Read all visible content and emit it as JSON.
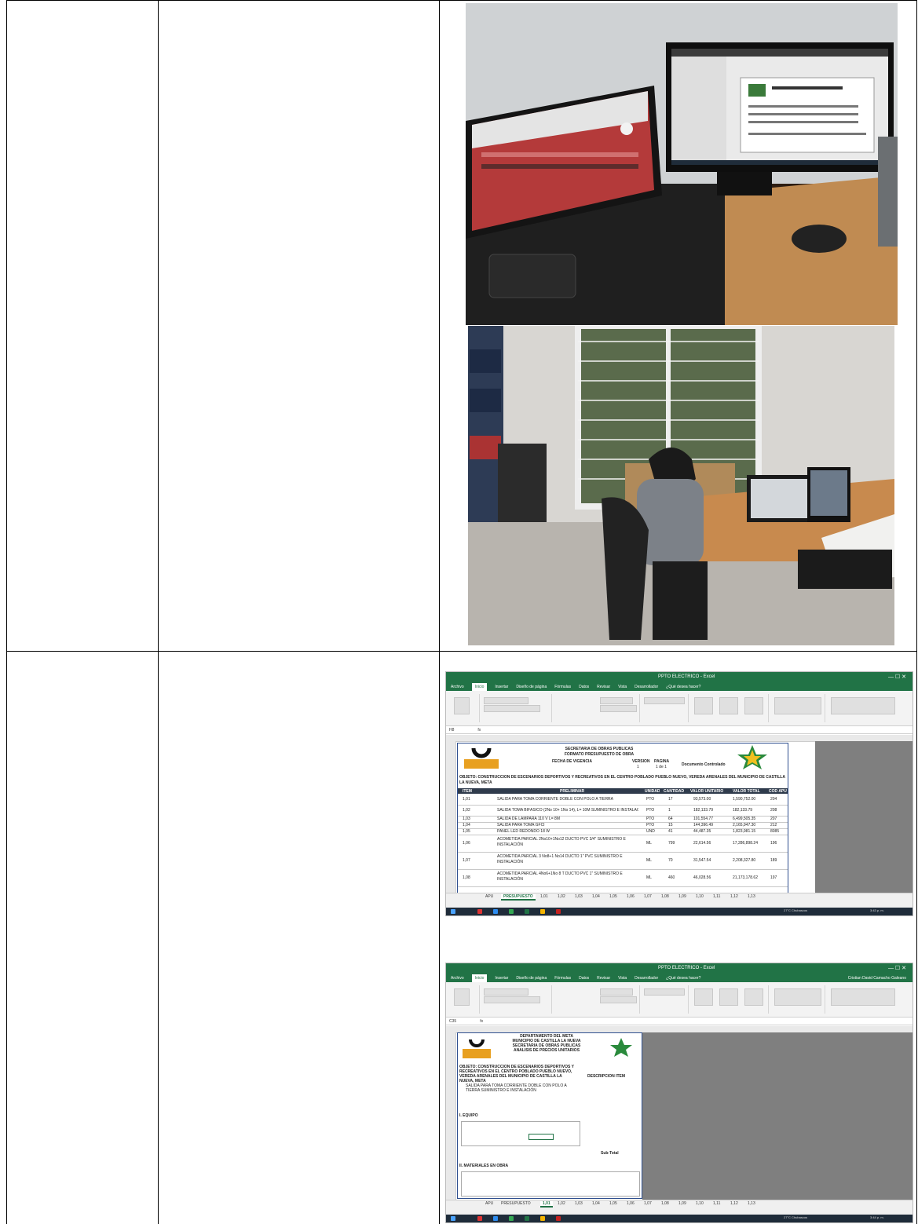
{
  "excel1": {
    "window_title": "PPTO ELECTRICO - Excel",
    "tabs": [
      "Archivo",
      "Inicio",
      "Insertar",
      "Diseño de página",
      "Fórmulas",
      "Datos",
      "Revisar",
      "Vista",
      "Desarrollador",
      "¿Qué desea hacer?"
    ],
    "cell_ref": "H8",
    "header1": "SECRETARÍA DE OBRAS PÚBLICAS",
    "header2": "FORMATO PRESUPUESTO DE OBRA",
    "fecha": "FECHA DE VIGENCIA",
    "version_label": "VERSIÓN",
    "version": "1",
    "pagina_label": "PAGINA",
    "pagina": "1 de 1",
    "doc_controlado": "Documento Controlado",
    "objeto": "OBJETO: CONSTRUCCIÓN DE ESCENARIOS DEPORTIVOS Y RECREATIVOS EN EL CENTRO POBLADO PUEBLO NUEVO, VEREDA ARENALES DEL MUNICIPIO DE CASTILLA LA NUEVA, META",
    "columns": [
      "ITEM",
      "PRELIMINAR",
      "UNIDAD",
      "CANTIDAD",
      "VALOR UNITARIO",
      "VALOR TOTAL",
      "COD APU"
    ],
    "rows": [
      {
        "item": "1,01",
        "desc": "SALIDA PARA TOMA CORRIENTE DOBLE CON POLO A TIERRA",
        "unit": "PTO",
        "qty": "17",
        "vu": "93,573.00",
        "vt": "1,590,752.00",
        "cod": "204"
      },
      {
        "item": "1,02",
        "desc": "SALIDA TOMA BIFÁSICO (2No 10+ 1No 14), L= 10M SUMINISTRO E INSTALACIÓN",
        "unit": "PTO",
        "qty": "1",
        "vu": "182,133.79",
        "vt": "182,133.79",
        "cod": "208"
      },
      {
        "item": "1,03",
        "desc": "SALIDA DE LAMPARA 110 V L= 8M",
        "unit": "PTO",
        "qty": "64",
        "vu": "101,554.77",
        "vt": "6,499,505.35",
        "cod": "207"
      },
      {
        "item": "1,04",
        "desc": "SALIDA PARA TOMA GFCI",
        "unit": "PTO",
        "qty": "15",
        "vu": "144,396.49",
        "vt": "2,165,947.30",
        "cod": "212"
      },
      {
        "item": "1,05",
        "desc": "PANEL LED REDONDO 18 W",
        "unit": "UND",
        "qty": "41",
        "vu": "44,487.35",
        "vt": "1,823,981.15",
        "cod": "8085"
      },
      {
        "item": "1,06",
        "desc": "ACOMETIDA PARCIAL 2No10+1No12 DUCTO PVC 3/4\" SUMINISTRO E INSTALACIÓN",
        "unit": "ML",
        "qty": "799",
        "vu": "22,614.56",
        "vt": "17,286,898.24",
        "cod": "196"
      },
      {
        "item": "1,07",
        "desc": "ACOMETIDA PARCIAL 3 No8+1 No14 DUCTO 1\" PVC SUMINISTRO E INSTALACIÓN",
        "unit": "ML",
        "qty": "70",
        "vu": "31,547.54",
        "vt": "2,208,327.80",
        "cod": "189"
      },
      {
        "item": "1,08",
        "desc": "ACOMETIDA PARCIAL 4No6+1No 8 T DUCTO PVC 1\" SUMINISTRO E INSTALACIÓN",
        "unit": "ML",
        "qty": "460",
        "vu": "46,028.56",
        "vt": "21,173,178.62",
        "cod": "197"
      }
    ],
    "sheet_tabs": [
      "APU",
      "PRESUPUESTO",
      "1,01",
      "1,02",
      "1,03",
      "1,04",
      "1,05",
      "1,06",
      "1,07",
      "1,08",
      "1,09",
      "1,10",
      "1,11",
      "1,12",
      "1,13"
    ],
    "active_tab": "PRESUPUESTO",
    "tray": "27°C Chubascos",
    "time": "3:43 p. m."
  },
  "excel2": {
    "window_title": "PPTO ELECTRICO - Excel",
    "user": "Cristian David Camacho Galeano",
    "cell_ref": "C35",
    "header1": "DEPARTAMENTO DEL META",
    "header2": "MUNICIPIO DE CASTILLA LA NUEVA",
    "header3": "SECRETARÍA DE OBRAS PÚBLICAS",
    "header4": "ANÁLISIS DE PRECIOS UNITARIOS",
    "objeto": "OBJETO: CONSTRUCCIÓN DE ESCENARIOS DEPORTIVOS Y RECREATIVOS EN EL CENTRO POBLADO PUEBLO NUEVO, VEREDA ARENALES DEL MUNICIPIO DE CASTILLA LA NUEVA, META",
    "descripcion_label": "DESCRIPCIÓN ÍTEM",
    "item_desc": "SALIDA PARA TOMA CORRIENTE DOBLE CON POLO A TIERRA SUMINISTRO E INSTALACIÓN",
    "equipo": "I. EQUIPO",
    "materiales": "II. MATERIALES EN OBRA",
    "subtotal": "Sub-Total",
    "sheet_tabs": [
      "APU",
      "PRESUPUESTO",
      "1,01",
      "1,02",
      "1,03",
      "1,04",
      "1,05",
      "1,06",
      "1,07",
      "1,08",
      "1,09",
      "1,10",
      "1,11",
      "1,12",
      "1,13"
    ],
    "active_tab": "1,01",
    "tray": "27°C Chubascos",
    "time": "3:44 p. m."
  }
}
